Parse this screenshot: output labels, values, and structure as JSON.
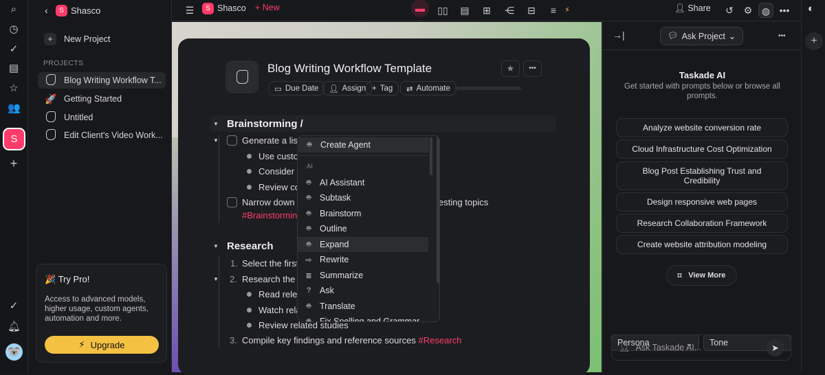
{
  "workspace": {
    "name": "Shasco",
    "initial": "S"
  },
  "sidebar": {
    "new_project": "New Project",
    "section": "PROJECTS",
    "items": [
      {
        "label": "Blog Writing Workflow T...",
        "icon": "document-icon",
        "active": true
      },
      {
        "label": "Getting Started",
        "icon": "rocket-icon"
      },
      {
        "label": "Untitled",
        "icon": "document-icon"
      },
      {
        "label": "Edit Client's Video Work...",
        "icon": "document-icon"
      }
    ]
  },
  "pro": {
    "title": "🎉 Try Pro!",
    "body": "Access to advanced models, higher usage, custom agents, automation and more.",
    "button": "Upgrade"
  },
  "topbar": {
    "new": "New",
    "share": "Share"
  },
  "doc": {
    "title": "Blog Writing Workflow Template",
    "chips": [
      "Due Date",
      "Assign",
      "Tag",
      "Automate"
    ],
    "sections": [
      {
        "heading": "Brainstorming /"
      },
      {
        "heading": "Research"
      }
    ],
    "lines": {
      "gen": "Generate a list",
      "use": "Use custo",
      "consider": "Consider",
      "review": "Review co",
      "narrow": "Narrow down",
      "narrow_tail": "esting topics",
      "tag1": "#Brainstormin",
      "r1n": "1.",
      "r1": "Select the first",
      "r2n": "2.",
      "r2": "Research the",
      "read": "Read relev",
      "watch": "Watch rela",
      "studies": "Review related studies",
      "r3n": "3.",
      "r3": "Compile key findings and reference sources",
      "tag2": "#Research"
    }
  },
  "menu": {
    "top": "Create Agent",
    "section": "AI",
    "items": [
      "AI Assistant",
      "Subtask",
      "Brainstorm",
      "Outline",
      "Expand",
      "Rewrite",
      "Summarize",
      "Ask",
      "Translate",
      "Fix Spelling and Grammar"
    ],
    "highlighted": "Expand"
  },
  "panel": {
    "mode": "Ask Project",
    "title": "Taskade AI",
    "subtitle": "Get started with prompts below or browse all prompts.",
    "prompts": [
      "Analyze website conversion rate",
      "Cloud Infrastructure Cost Optimization",
      "Blog Post Establishing Trust and Credibility",
      "Design responsive web pages",
      "Research Collaboration Framework",
      "Create website attribution modeling"
    ],
    "view_more": "View More",
    "persona": "Persona",
    "tone": "Tone",
    "input_placeholder": "Ask Taskade AI..."
  },
  "colors": {
    "accent": "#ff3b6b",
    "upgrade": "#f5c143"
  }
}
